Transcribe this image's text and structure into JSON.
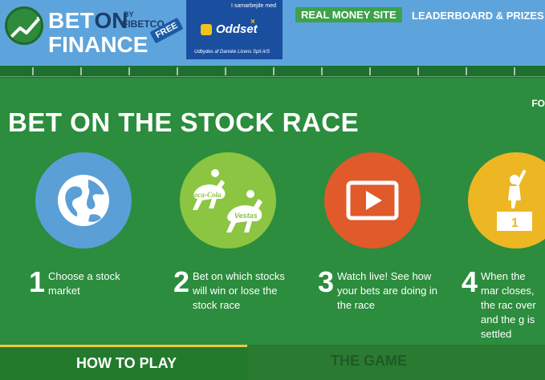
{
  "header": {
    "logo": {
      "bet": "BET",
      "on": "ON",
      "by": "BY",
      "fibetco": "FIBETCO",
      "finance": "FINANCE",
      "free": "FREE"
    },
    "partner": {
      "top": "I samarbejde med",
      "name": "Oddset",
      "bottom": "Udbydes af Danske Licens Spil A/S"
    },
    "nav": {
      "real_money": "REAL MONEY SITE",
      "leaderboard": "LEADERBOARD & PRIZES"
    }
  },
  "main": {
    "title": "BET ON THE STOCK RACE",
    "right_cut": "FO",
    "steps": [
      {
        "num": "1",
        "text": "Choose a stock market"
      },
      {
        "num": "2",
        "text": "Bet on which stocks will win or lose the stock race"
      },
      {
        "num": "3",
        "text": "Watch live! See how your bets are doing in the race"
      },
      {
        "num": "4",
        "text": "When the mar closes, the rac over and the g is settled"
      }
    ],
    "horse_labels": {
      "left": "Coca-Cola",
      "right": "Vestas"
    },
    "podium_label": "1"
  },
  "tabs": {
    "how_to_play": "HOW TO PLAY",
    "the_game": "THE GAME"
  },
  "colors": {
    "header_bg": "#5ea4dc",
    "field_green": "#2b8d3d",
    "circle_blue": "#5b9fd7",
    "circle_green": "#8bc541",
    "circle_orange": "#e05a2a",
    "circle_yellow": "#edb623",
    "accent_yellow": "#f1c73e"
  }
}
